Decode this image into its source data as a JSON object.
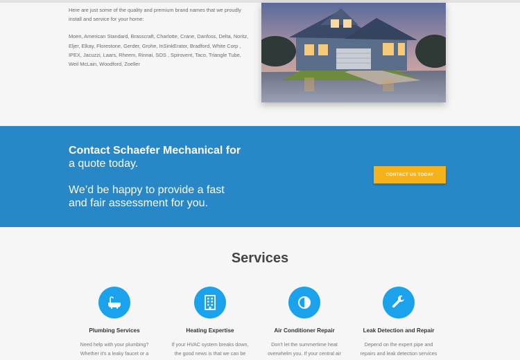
{
  "brands": {
    "intro": "Here are just some of the quality and premium brand names that we proudly install and service for your home:",
    "list": "Moen, American Standard, Brasscraft, Charlotte, Crane, Danfoss, Delta, Noritz, Eljer, Elkay, Florestone, Gerder, Grohe, InSinkErator, Bradford, White Corp , IPEX, Jacuzzi, Laars, Rheem, Rinnai, SOS , Spirovent, Taco, Triangle Tube, Weil McLain, Woodford, Zoeller"
  },
  "cta": {
    "line1_bold": "Contact Schaefer Mechanical for",
    "line2": "a quote today.",
    "line3": "We’d be happy to provide a fast",
    "line4": "and fair assessment for you.",
    "button_label": "CONTACT US TODAY"
  },
  "services": {
    "title": "Services",
    "items": [
      {
        "title": "Plumbing Services",
        "desc": "Need help with your plumbing? Whether it's a leaky faucet or a",
        "icon": "bathtub-icon"
      },
      {
        "title": "Heating Expertise",
        "desc": "If your HVAC system breaks down, the good news is that we can be",
        "icon": "building-icon"
      },
      {
        "title": "Air Conditioner Repair",
        "desc": "Don't let the summertime heat overwhelm you. If your central air",
        "icon": "half-circle-icon"
      },
      {
        "title": "Leak Detection and Repair",
        "desc": "Depend on the expert pipe and repairs and leak detection services",
        "icon": "wrench-icon"
      }
    ]
  },
  "colors": {
    "cta_background": "#2887c6",
    "cta_button": "#f6b21c",
    "service_icon": "#1aa3ec"
  }
}
